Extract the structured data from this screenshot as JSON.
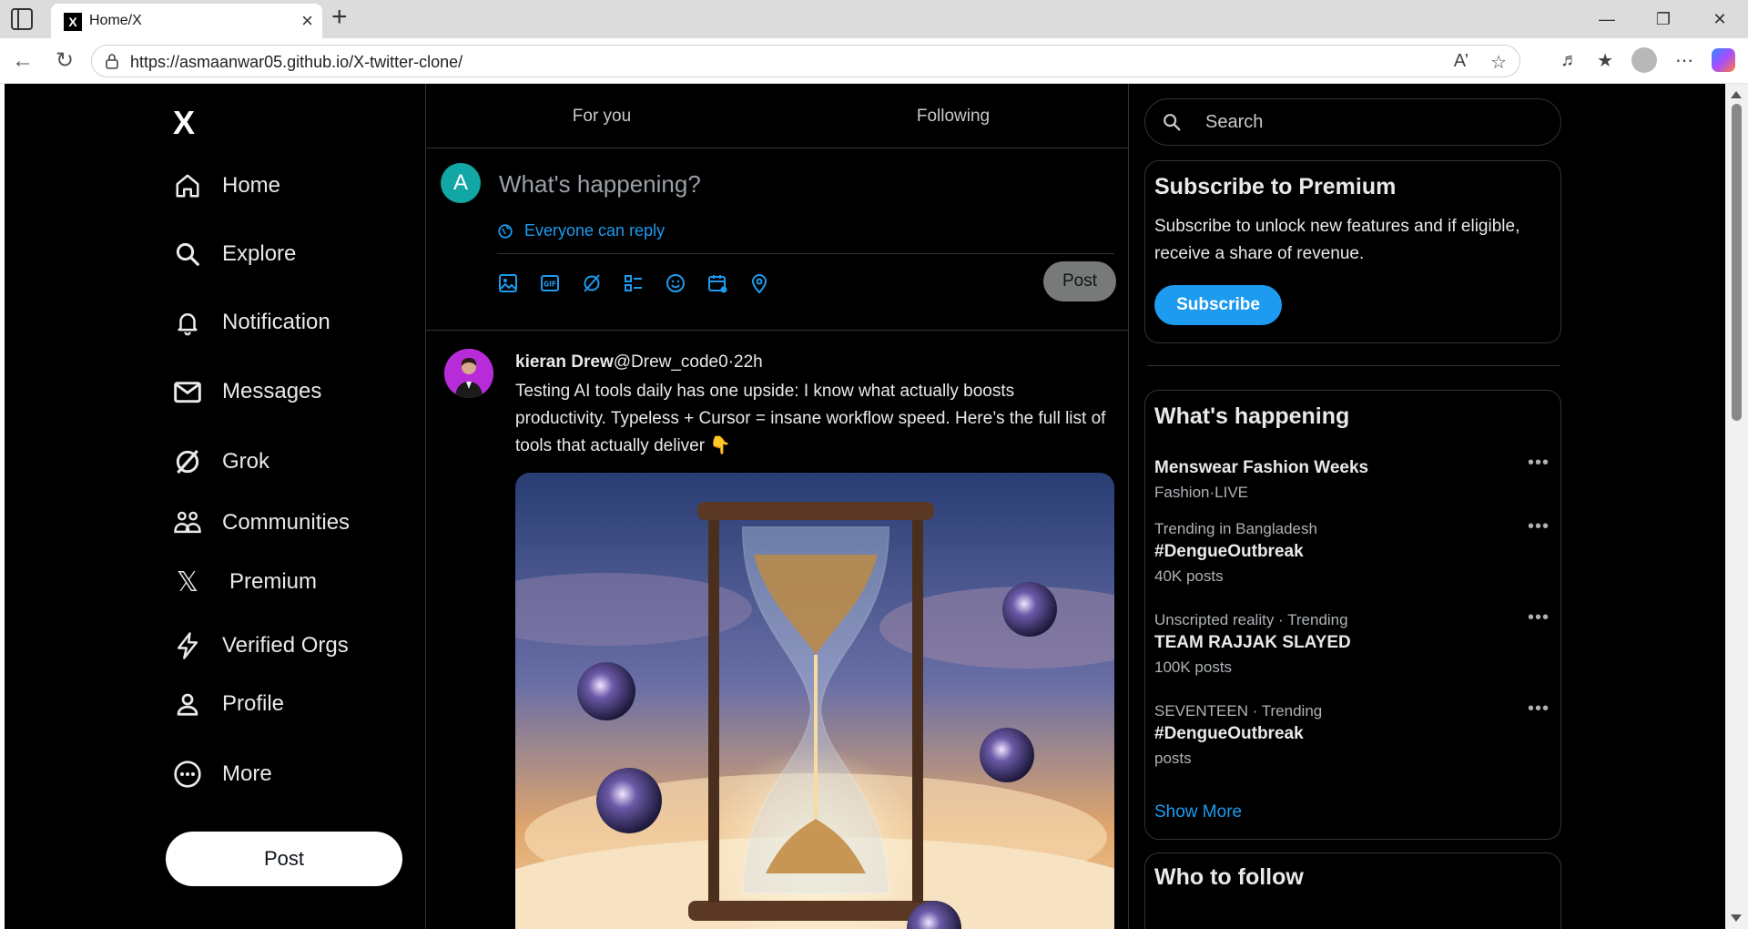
{
  "browser": {
    "tab_title": "Home/X",
    "tab_favicon": "X",
    "url": "https://asmaanwar05.github.io/X-twitter-clone/",
    "new_tab": "+",
    "close_tab": "×"
  },
  "nav": {
    "logo": "X",
    "items": [
      {
        "label": "Home",
        "icon": "home-icon"
      },
      {
        "label": "Explore",
        "icon": "search-icon"
      },
      {
        "label": "Notification",
        "icon": "bell-icon"
      },
      {
        "label": "Messages",
        "icon": "mail-icon"
      },
      {
        "label": "Grok",
        "icon": "grok-icon"
      },
      {
        "label": "Communities",
        "icon": "communities-icon"
      },
      {
        "label": "Premium",
        "icon": "x-logo-icon"
      },
      {
        "label": "Verified Orgs",
        "icon": "lightning-icon"
      },
      {
        "label": "Profile",
        "icon": "user-icon"
      },
      {
        "label": "More",
        "icon": "more-circle-icon"
      }
    ],
    "post_button": "Post"
  },
  "feed": {
    "tabs": [
      "For you",
      "Following"
    ],
    "compose": {
      "avatar_letter": "A",
      "placeholder": "What's happening?",
      "reply_setting": "Everyone can reply",
      "post_button": "Post"
    },
    "tweet": {
      "name": "kieran Drew",
      "handle": "@Drew_code0",
      "time": "·22h",
      "text": "Testing AI tools daily has one upside: I know what actually boosts productivity. Typeless + Cursor = insane workflow speed. Here’s the full list of tools that actually deliver 👇"
    }
  },
  "right": {
    "search_placeholder": "Search",
    "premium": {
      "title": "Subscribe to Premium",
      "text": "Subscribe to unlock new features and if eligible, receive a share of revenue.",
      "button": "Subscribe"
    },
    "happening": {
      "title": "What's happening",
      "trends": [
        {
          "meta": "",
          "title": "Menswear Fashion Weeks",
          "count": "Fashion·LIVE"
        },
        {
          "meta": "Trending in Bangladesh",
          "title": "#DengueOutbreak",
          "count": "40K posts"
        },
        {
          "meta": "Unscripted reality · Trending",
          "title": "TEAM RAJJAK SLAYED",
          "count": "100K posts"
        },
        {
          "meta": "SEVENTEEN · Trending",
          "title": "#DengueOutbreak",
          "count": "posts"
        }
      ],
      "show_more": "Show More"
    },
    "who_to_follow": {
      "title": "Who to follow"
    }
  },
  "colors": {
    "accent": "#1d9bf0",
    "background": "#000000",
    "border": "#2f3336"
  }
}
